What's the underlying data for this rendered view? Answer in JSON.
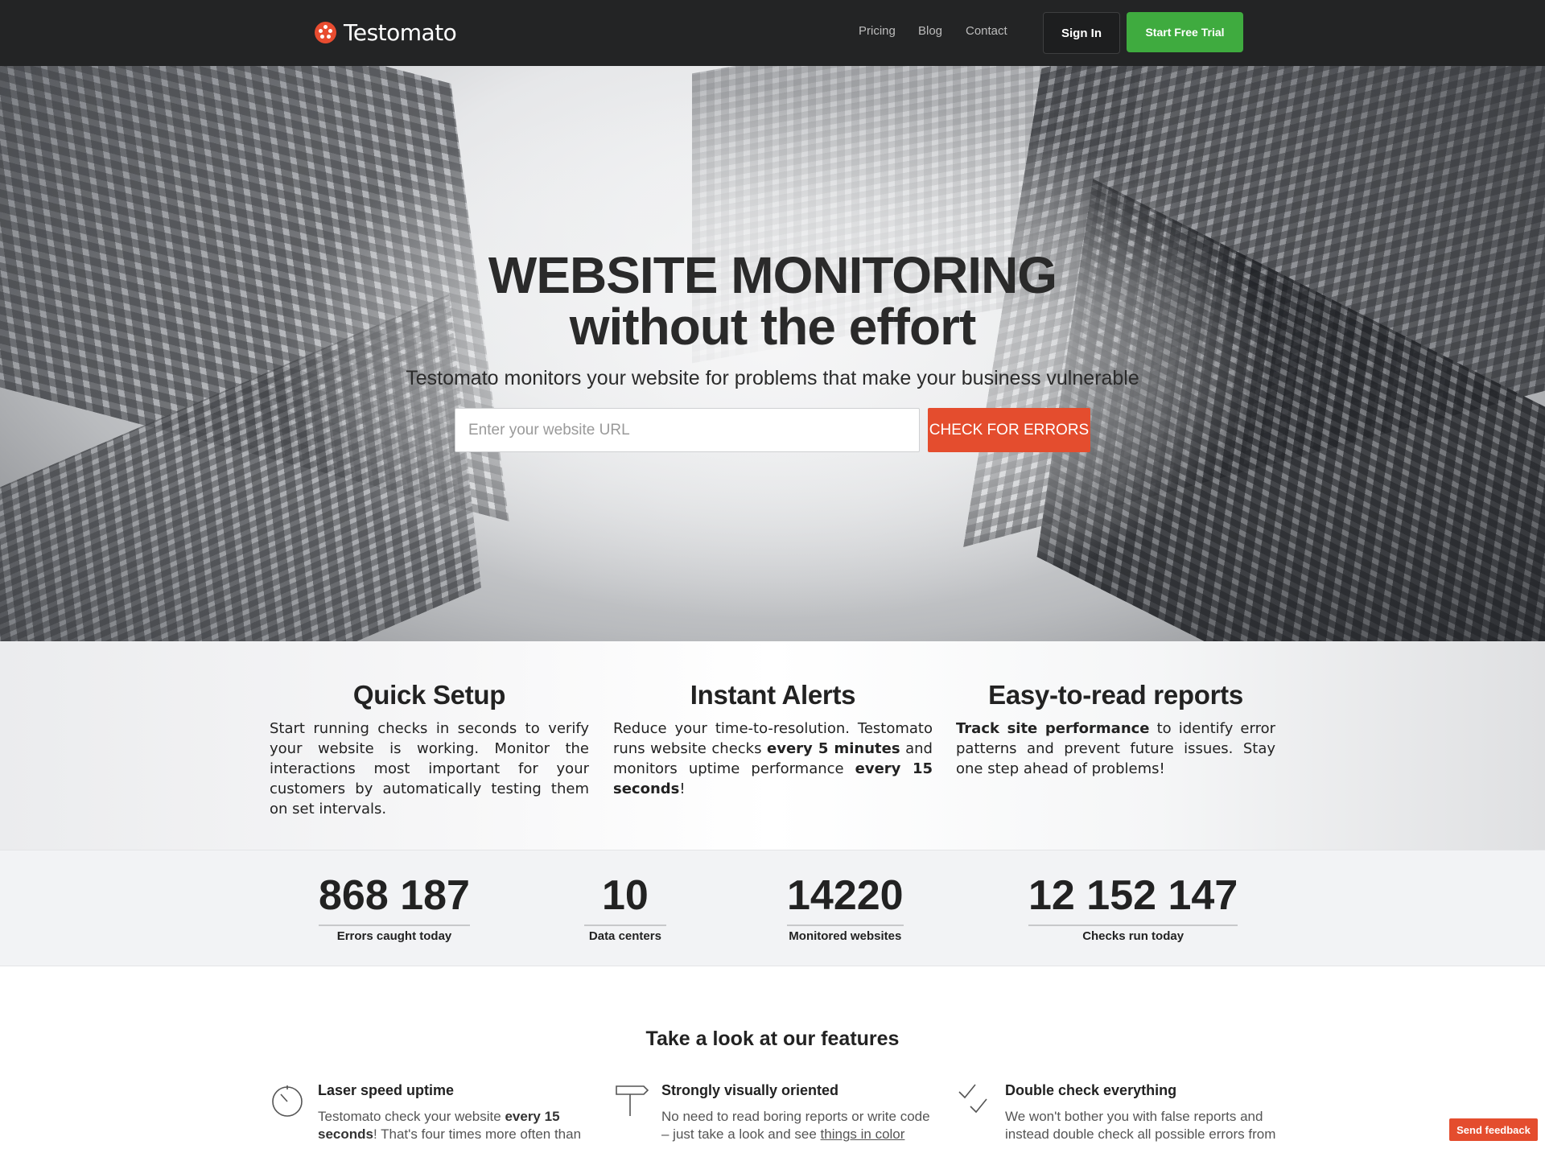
{
  "nav": {
    "logo_text": "Testomato",
    "links": [
      "Pricing",
      "Blog",
      "Contact"
    ],
    "sign_in": "Sign In",
    "start_trial": "Start Free Trial"
  },
  "hero": {
    "title_line1": "WEBSITE MONITORING",
    "title_line2": "without the effort",
    "subtitle": "Testomato monitors your website for problems that make your business vulnerable",
    "url_placeholder": "Enter your website URL",
    "check_button": "CHECK FOR ERRORS"
  },
  "pillars": [
    {
      "title": "Quick Setup",
      "text": "Start running checks in seconds to verify your website is working. Monitor the interactions most important for your customers by automatically testing them on set intervals."
    },
    {
      "title": "Instant Alerts",
      "text_a": "Reduce your time-to-resolution. Testomato runs website checks ",
      "bold_a": "every 5 minutes",
      "text_b": " and monitors uptime performance ",
      "bold_b": "every 15 seconds",
      "text_c": "!"
    },
    {
      "title": "Easy-to-read reports",
      "bold_a": "Track site performance",
      "text_a": " to identify error patterns and prevent future issues. Stay one step ahead of problems!"
    }
  ],
  "stats": [
    {
      "value": "868 187",
      "label": "Errors caught today"
    },
    {
      "value": "10",
      "label": "Data centers"
    },
    {
      "value": "14220",
      "label": "Monitored websites"
    },
    {
      "value": "12 152 147",
      "label": "Checks run today"
    }
  ],
  "features": {
    "title": "Take a look at our features",
    "items": [
      {
        "icon": "stopwatch-icon",
        "title": "Laser speed uptime",
        "text_a": "Testomato check your website ",
        "bold_a": "every 15 seconds",
        "text_b": "! That's four times more often than"
      },
      {
        "icon": "signpost-icon",
        "title": "Strongly visually oriented",
        "text_a": "No need to read boring reports or write code – just take a look and see ",
        "link_a": "things in color"
      },
      {
        "icon": "double-check-icon",
        "title": "Double check everything",
        "text_a": "We won't bother you with false reports and instead double check all possible errors from"
      }
    ]
  },
  "feedback": "Send feedback",
  "colors": {
    "nav_bg": "#232425",
    "accent_red": "#e44d2e",
    "trial_green": "#3fab3f"
  }
}
